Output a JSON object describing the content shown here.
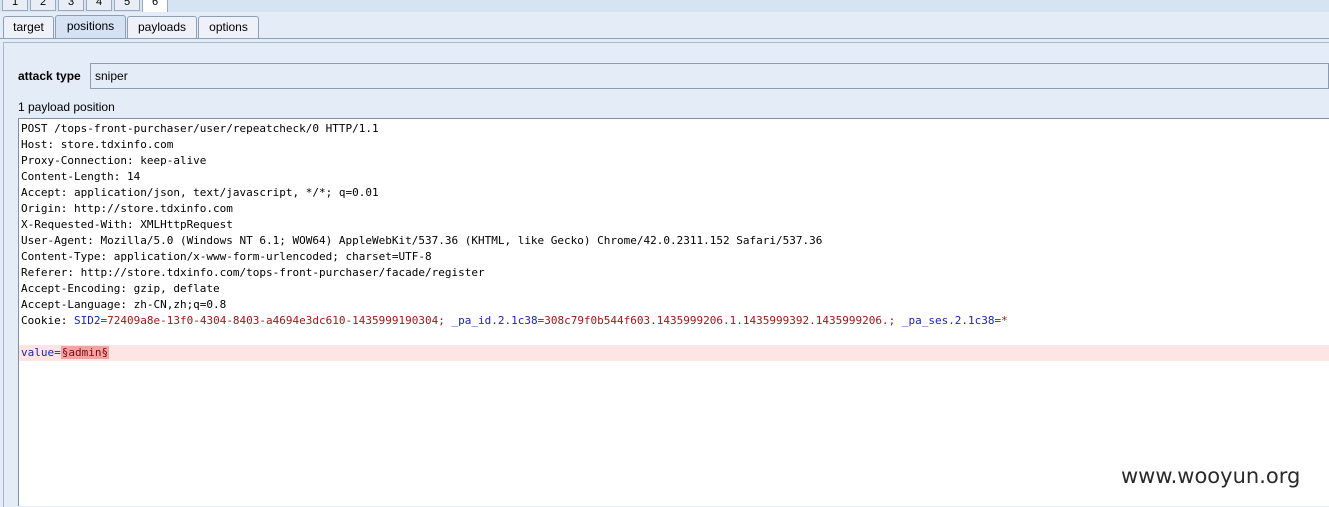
{
  "top_tabs": [
    "1",
    "2",
    "3",
    "4",
    "5",
    "6"
  ],
  "sub_tabs": [
    "target",
    "positions",
    "payloads",
    "options"
  ],
  "attack_type": {
    "label": "attack type",
    "value": "sniper"
  },
  "payload_count": "1 payload position",
  "request_lines": [
    "POST /tops-front-purchaser/user/repeatcheck/0 HTTP/1.1",
    "Host: store.tdxinfo.com",
    "Proxy-Connection: keep-alive",
    "Content-Length: 14",
    "Accept: application/json, text/javascript, */*; q=0.01",
    "Origin: http://store.tdxinfo.com",
    "X-Requested-With: XMLHttpRequest",
    "User-Agent: Mozilla/5.0 (Windows NT 6.1; WOW64) AppleWebKit/537.36 (KHTML, like Gecko) Chrome/42.0.2311.152 Safari/537.36",
    "Content-Type: application/x-www-form-urlencoded; charset=UTF-8",
    "Referer: http://store.tdxinfo.com/tops-front-purchaser/facade/register",
    "Accept-Encoding: gzip, deflate",
    "Accept-Language: zh-CN,zh;q=0.8"
  ],
  "cookie": {
    "prefix": "Cookie: ",
    "sid_name": "SID2",
    "sid_value": "=72409a8e-13f0-4304-8403-a4694e3dc610-1435999190304; ",
    "pa_id_name": "_pa_id.2.1c38",
    "pa_id_value": "=308c79f0b544f603.1435999206.1.1435999392.1435999206.; ",
    "pa_ses_name": "_pa_ses.2.1c38",
    "pa_ses_value": "=*"
  },
  "body_param": {
    "name": "value",
    "equals": "=",
    "payload": "§admin§"
  },
  "watermark": "www.wooyun.org",
  "colors": {
    "param_name": "#1a24b8",
    "param_value": "#a11616",
    "payload_highlight": "#f4a3a3",
    "payload_row": "#fde5e5"
  }
}
